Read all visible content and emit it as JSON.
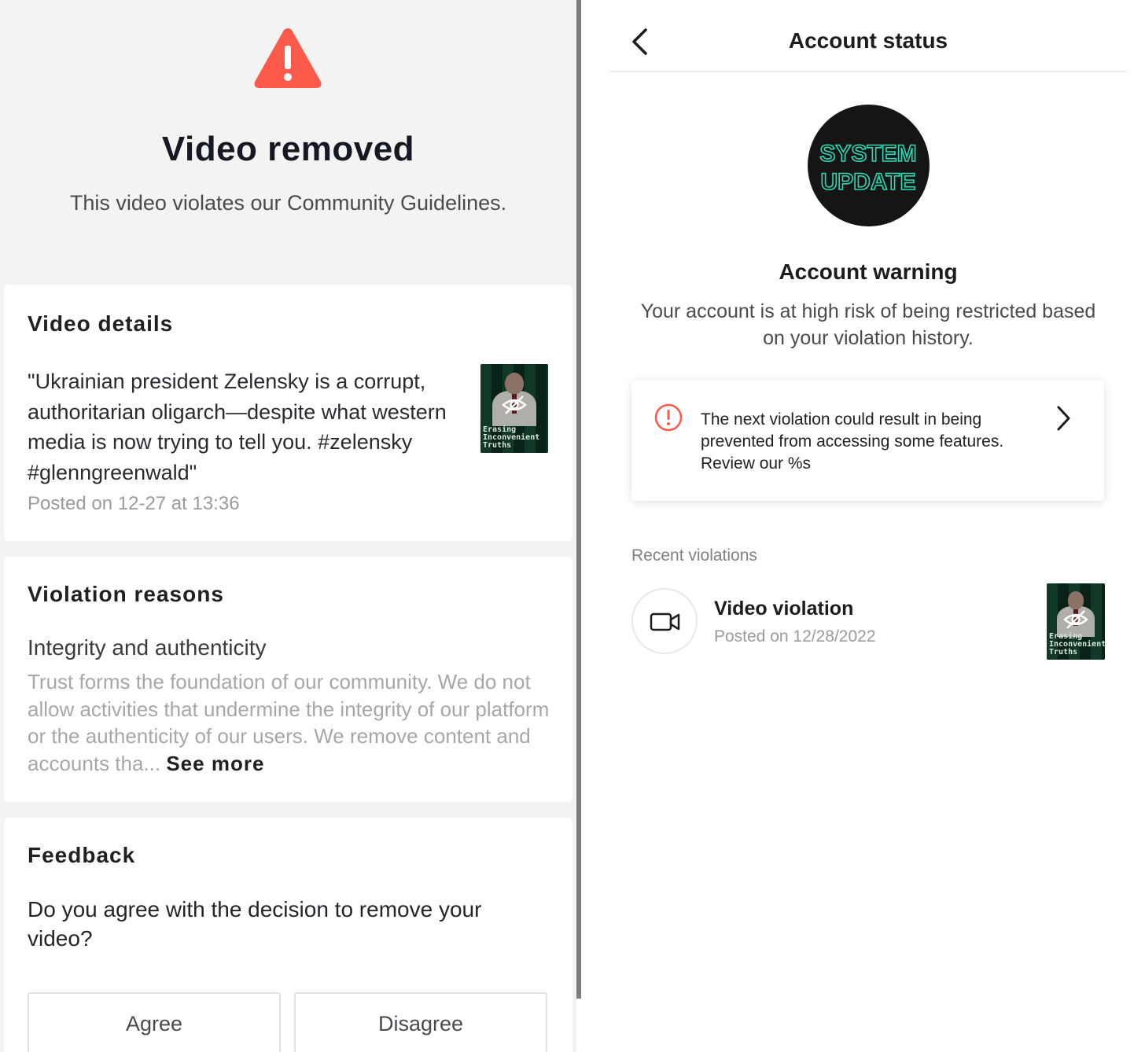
{
  "left_panel": {
    "title": "Video removed",
    "subtitle": "This video violates our Community Guidelines.",
    "video_details": {
      "heading": "Video details",
      "description": "\"Ukrainian president Zelensky is a corrupt, authoritarian oligarch—despite what western media is now trying to tell you. #zelensky #glenngreenwald\"",
      "posted": "Posted on 12-27 at 13:36",
      "thumbnail_caption": "Erasing Inconvenient Truths"
    },
    "violation_reasons": {
      "heading": "Violation reasons",
      "category": "Integrity and authenticity",
      "body": "Trust forms the foundation of our community. We do not allow activities that undermine the integrity of our platform or the authenticity of our users. We remove content and accounts tha...",
      "see_more": "See more"
    },
    "feedback": {
      "heading": "Feedback",
      "question": "Do you agree with the decision to remove your video?",
      "agree_label": "Agree",
      "disagree_label": "Disagree"
    }
  },
  "right_panel": {
    "nav_title": "Account status",
    "badge_text_top": "SYSTEM",
    "badge_text_bottom": "UPDATE",
    "warning_title": "Account warning",
    "warning_text": "Your account is at high risk of being restricted based on your violation history.",
    "notice_text": "The next violation could result in being prevented from accessing some features. Review our %s",
    "recent_label": "Recent violations",
    "violation": {
      "title": "Video violation",
      "posted": "Posted on 12/28/2022",
      "thumbnail_caption": "Erasing Inconvenient Truths"
    }
  },
  "colors": {
    "warning_red": "#fe5a4b",
    "badge_teal": "#2fd8b4",
    "badge_bg": "#151515"
  },
  "icons": [
    "warning-triangle-icon",
    "eye-slash-icon",
    "back-chevron-icon",
    "alert-circle-icon",
    "chevron-right-icon",
    "video-camera-icon"
  ]
}
